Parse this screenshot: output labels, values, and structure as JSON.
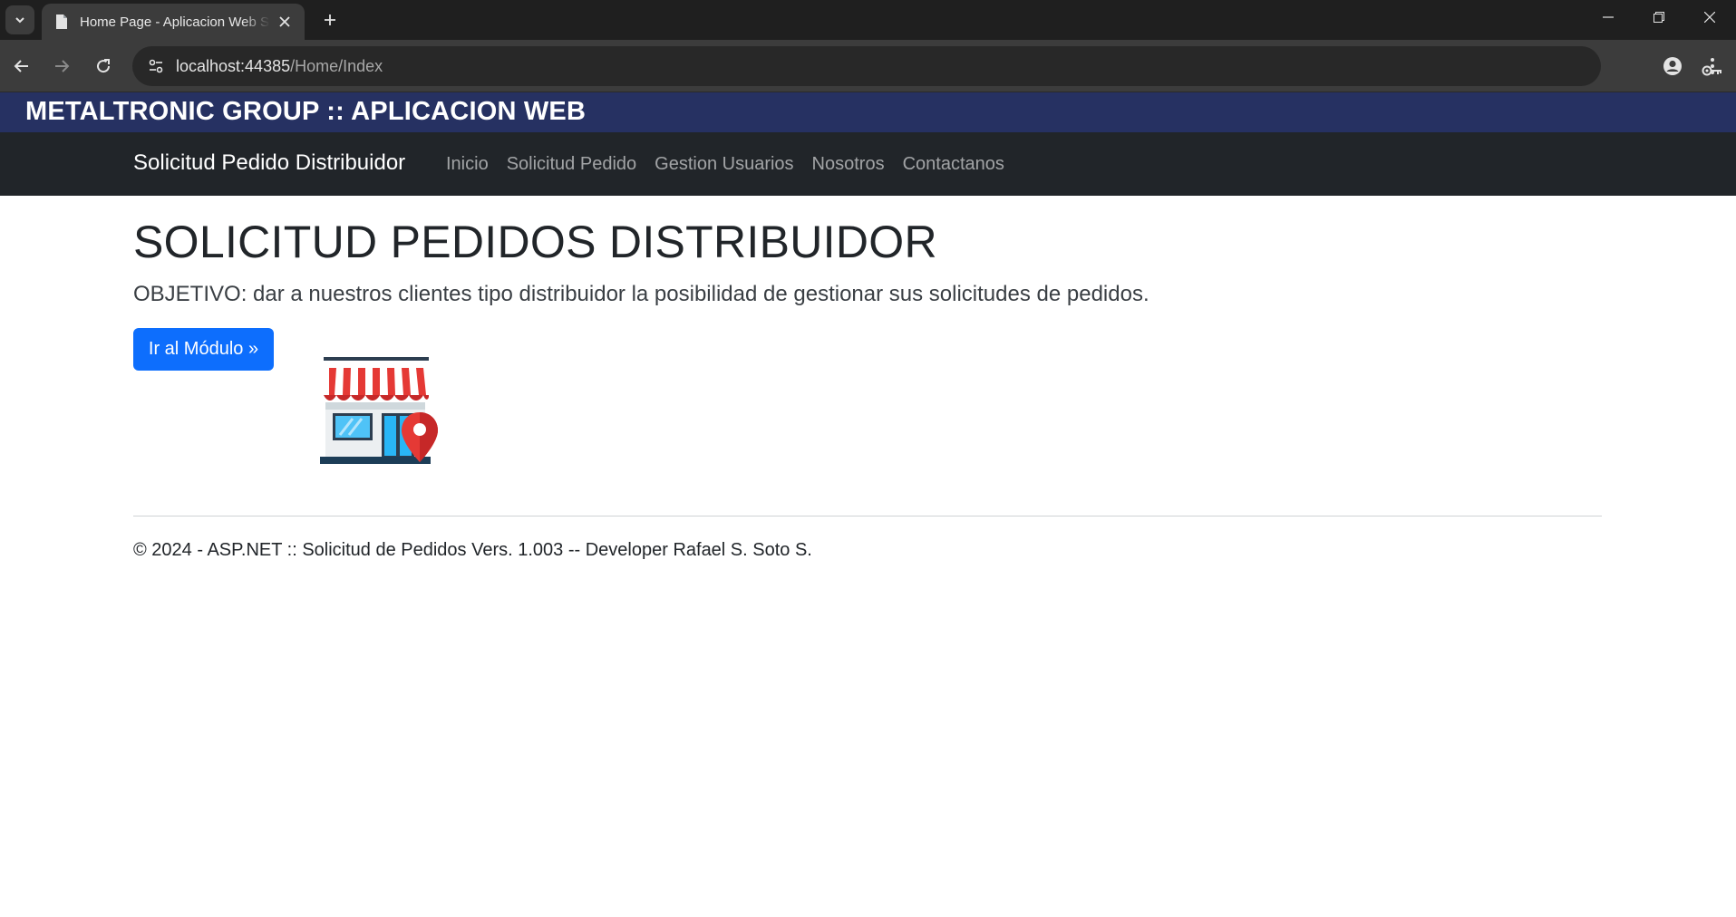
{
  "browser": {
    "tab_title": "Home Page - Aplicacion Web Solicitud",
    "url_host": "localhost:44385",
    "url_path": "/Home/Index",
    "icons": [
      "tab-list-icon",
      "page-icon",
      "close-icon",
      "plus-icon",
      "minimize-icon",
      "restore-icon",
      "close-window-icon",
      "back-icon",
      "forward-icon",
      "reload-icon",
      "site-info-icon",
      "key-icon",
      "star-icon",
      "profile-icon",
      "more-vert-icon"
    ]
  },
  "brand_bar": {
    "title": "METALTRONIC GROUP :: APLICACION WEB",
    "color": "#263162"
  },
  "navbar": {
    "brand": "Solicitud Pedido Distribuidor",
    "links": [
      "Inicio",
      "Solicitud Pedido",
      "Gestion Usuarios",
      "Nosotros",
      "Contactanos"
    ],
    "color": "#212529"
  },
  "main": {
    "heading": "SOLICITUD PEDIDOS DISTRIBUIDOR",
    "lead": "OBJETIVO: dar a nuestros clientes tipo distribuidor la posibilidad de gestionar sus solicitudes de pedidos.",
    "cta_label": "Ir al Módulo »",
    "cta_color": "#0d6efd",
    "image_icon": "store-location-icon"
  },
  "footer": {
    "text": "© 2024 - ASP.NET :: Solicitud de Pedidos Vers. 1.003 -- Developer Rafael S. Soto S."
  }
}
